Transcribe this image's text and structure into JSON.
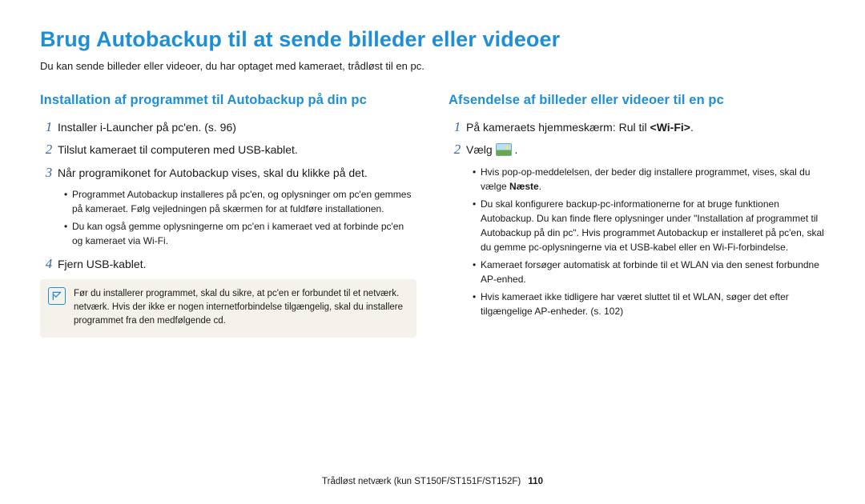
{
  "title": "Brug Autobackup til at sende billeder eller videoer",
  "intro": "Du kan sende billeder eller videoer, du har optaget med kameraet, trådløst til en pc.",
  "left": {
    "heading": "Installation af programmet til Autobackup på din pc",
    "steps": {
      "s1": {
        "n": "1",
        "t": "Installer i-Launcher på pc'en. (s. 96)"
      },
      "s2": {
        "n": "2",
        "t": "Tilslut kameraet til computeren med USB-kablet."
      },
      "s3": {
        "n": "3",
        "t": "Når programikonet for Autobackup vises, skal du klikke på det."
      },
      "s3_subs": {
        "a": "Programmet Autobackup installeres på pc'en, og oplysninger om pc'en gemmes på kameraet. Følg vejledningen på skærmen for at fuldføre installationen.",
        "b": "Du kan også gemme oplysningerne om pc'en i kameraet ved at forbinde pc'en og kameraet via Wi-Fi."
      },
      "s4": {
        "n": "4",
        "t": "Fjern USB-kablet."
      }
    },
    "note": "Før du installerer programmet, skal du sikre, at pc'en er forbundet til et netværk. netværk. Hvis der ikke er nogen internetforbindelse tilgængelig, skal du installere programmet fra den medfølgende cd."
  },
  "right": {
    "heading": "Afsendelse af billeder eller videoer til en pc",
    "steps": {
      "s1": {
        "n": "1",
        "t_pre": "På kameraets hjemmeskærm: Rul til ",
        "t_bold": "<Wi-Fi>",
        "t_post": "."
      },
      "s2": {
        "n": "2",
        "t": "Vælg "
      }
    },
    "subs": {
      "a_pre": "Hvis pop-op-meddelelsen, der beder dig installere programmet, vises, skal du vælge ",
      "a_bold": "Næste",
      "a_post": ".",
      "b": "Du skal konfigurere backup-pc-informationerne for at bruge funktionen Autobackup. Du kan finde flere oplysninger under \"Installation af programmet til Autobackup på din pc\". Hvis programmet Autobackup er installeret på pc'en, skal du gemme pc-oplysningerne via et USB-kabel eller en Wi-Fi-forbindelse.",
      "c": "Kameraet forsøger automatisk at forbinde til et WLAN via den senest forbundne AP-enhed.",
      "d": "Hvis kameraet ikke tidligere har været sluttet til et WLAN, søger det efter tilgængelige AP-enheder. (s. 102)"
    }
  },
  "footer": {
    "section": "Trådløst netværk (kun ST150F/ST151F/ST152F)",
    "page": "110"
  }
}
